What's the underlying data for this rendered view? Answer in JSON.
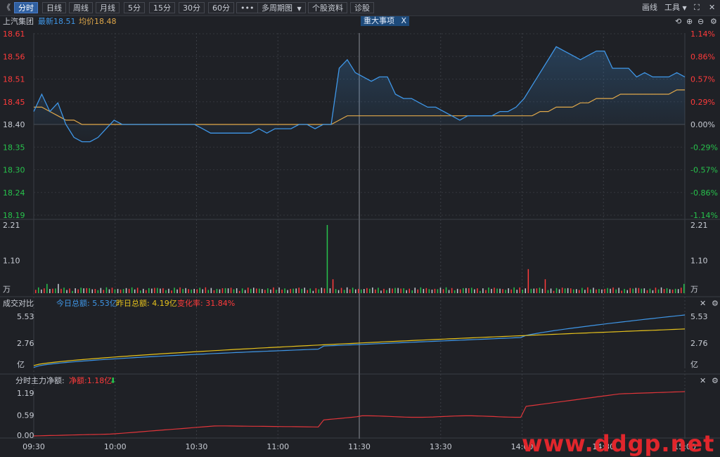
{
  "toolbar": {
    "collapse_glyph": "《",
    "tabs": [
      "分时",
      "日线",
      "周线",
      "月线",
      "5分",
      "15分",
      "30分",
      "60分"
    ],
    "active_tab": "分时",
    "more_label": "•••",
    "multi_period_label": "多周期图",
    "stock_info_label": "个股资料",
    "diagnose_label": "诊股",
    "draw_label": "画线",
    "tools_label": "工具",
    "expand_glyph": "⛶",
    "close_glyph": "✕"
  },
  "header": {
    "stock_name": "上汽集团",
    "latest": "最新18.51",
    "avg": "均价18.48",
    "event_badge": "重大事项",
    "event_badge_close": "X"
  },
  "price_panel": {
    "left_ticks": [
      "18.61",
      "18.56",
      "18.51",
      "18.45",
      "18.40",
      "18.35",
      "18.30",
      "18.24",
      "18.19"
    ],
    "right_ticks": [
      "1.14%",
      "0.86%",
      "0.57%",
      "0.29%",
      "0.00%",
      "-0.29%",
      "-0.57%",
      "-0.86%",
      "-1.14%"
    ],
    "price_range": [
      18.19,
      18.61
    ],
    "prev_close": 18.4,
    "colors": {
      "up": "#ff3b3b",
      "down": "#27c24c",
      "neutral": "#c8ccd4",
      "price_line": "#3f97e8",
      "avg_line": "#e0a84a"
    }
  },
  "volume_panel": {
    "left_ticks": [
      "2.21",
      "1.10",
      "万"
    ],
    "right_ticks": [
      "2.21",
      "1.10",
      "万"
    ],
    "max": 2.21
  },
  "amount_panel": {
    "title": "成交对比",
    "today": "今日总额: 5.53亿",
    "yesterday": "昨日总额: 4.19亿",
    "change": "变化率: 31.84%",
    "left_ticks": [
      "5.53",
      "2.76",
      "亿"
    ],
    "right_ticks": [
      "5.53",
      "2.76",
      "亿"
    ],
    "colors": {
      "today": "#3f97e8",
      "yesterday": "#e6c21c"
    }
  },
  "netflow_panel": {
    "title": "分时主力净额:",
    "net": "净额:1.18亿",
    "arrow": "⬇",
    "left_ticks": [
      "1.19",
      "0.59",
      "0.00"
    ],
    "color": "#e0353a"
  },
  "time_axis": [
    "09:30",
    "10:00",
    "10:30",
    "11:00",
    "11:30",
    "13:30",
    "14:00",
    "14:30",
    "15:00"
  ],
  "panel_controls": {
    "close": "✕",
    "settings": "⚙",
    "refresh": "⟲",
    "zoom_in": "⊕",
    "zoom_out": "⊖"
  },
  "watermark": "www.ddgp.net",
  "chart_data": {
    "type": "line",
    "series": [
      {
        "name": "最新",
        "values": [
          18.43,
          18.47,
          18.43,
          18.45,
          18.4,
          18.37,
          18.36,
          18.36,
          18.37,
          18.39,
          18.41,
          18.4,
          18.4,
          18.4,
          18.4,
          18.4,
          18.4,
          18.4,
          18.4,
          18.4,
          18.4,
          18.39,
          18.38,
          18.38,
          18.38,
          18.38,
          18.38,
          18.38,
          18.39,
          18.38,
          18.39,
          18.39,
          18.39,
          18.4,
          18.4,
          18.39,
          18.4,
          18.4,
          18.53,
          18.55,
          18.52,
          18.51,
          18.5,
          18.51,
          18.51,
          18.47,
          18.46,
          18.46,
          18.45,
          18.44,
          18.44,
          18.43,
          18.42,
          18.41,
          18.42,
          18.42,
          18.42,
          18.42,
          18.43,
          18.43,
          18.44,
          18.46,
          18.49,
          18.52,
          18.55,
          18.58,
          18.57,
          18.56,
          18.55,
          18.56,
          18.57,
          18.57,
          18.53,
          18.53,
          18.53,
          18.51,
          18.52,
          18.51,
          18.51,
          18.51,
          18.52,
          18.51
        ]
      },
      {
        "name": "均价",
        "values": [
          18.44,
          18.44,
          18.43,
          18.42,
          18.41,
          18.41,
          18.4,
          18.4,
          18.4,
          18.4,
          18.4,
          18.4,
          18.4,
          18.4,
          18.4,
          18.4,
          18.4,
          18.4,
          18.4,
          18.4,
          18.4,
          18.4,
          18.4,
          18.4,
          18.4,
          18.4,
          18.4,
          18.4,
          18.4,
          18.4,
          18.4,
          18.4,
          18.4,
          18.4,
          18.4,
          18.4,
          18.4,
          18.4,
          18.41,
          18.42,
          18.42,
          18.42,
          18.42,
          18.42,
          18.42,
          18.42,
          18.42,
          18.42,
          18.42,
          18.42,
          18.42,
          18.42,
          18.42,
          18.42,
          18.42,
          18.42,
          18.42,
          18.42,
          18.42,
          18.42,
          18.42,
          18.42,
          18.42,
          18.43,
          18.43,
          18.44,
          18.44,
          18.44,
          18.45,
          18.45,
          18.46,
          18.46,
          18.46,
          18.47,
          18.47,
          18.47,
          18.47,
          18.47,
          18.47,
          18.47,
          18.48,
          18.48
        ]
      }
    ]
  }
}
